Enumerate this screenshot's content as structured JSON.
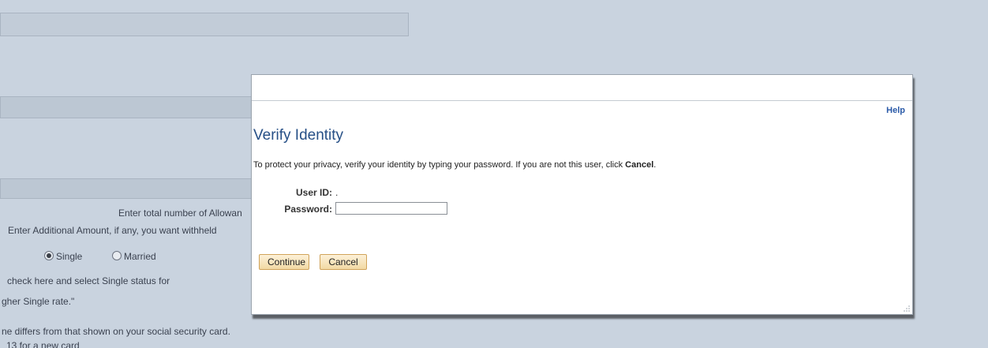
{
  "background": {
    "row_allowances": "Enter total number of Allowan",
    "row_additional": "Enter Additional Amount, if any, you want withheld",
    "radio_single": "Single",
    "radio_married": "Married",
    "line_check": "check here and select Single status for",
    "line_rate": "gher Single rate.\"",
    "line_differs": "ne differs from that shown on your social security card.",
    "line_card": "13 for a new card"
  },
  "modal": {
    "help": "Help",
    "title": "Verify Identity",
    "instructions_prefix": "To protect your privacy, verify your identity by typing your password. If you are not this user, click ",
    "instructions_bold": "Cancel",
    "instructions_suffix": ".",
    "userid_label": "User ID:",
    "userid_value": ".",
    "password_label": "Password:",
    "password_value": "",
    "continue_label": "Continue",
    "cancel_label": "Cancel"
  },
  "colors": {
    "page_background": "#c9d3df",
    "heading": "#264f86",
    "link": "#2a5aa8",
    "button_fill": "#f2d9a4",
    "button_border": "#d0a35a"
  }
}
